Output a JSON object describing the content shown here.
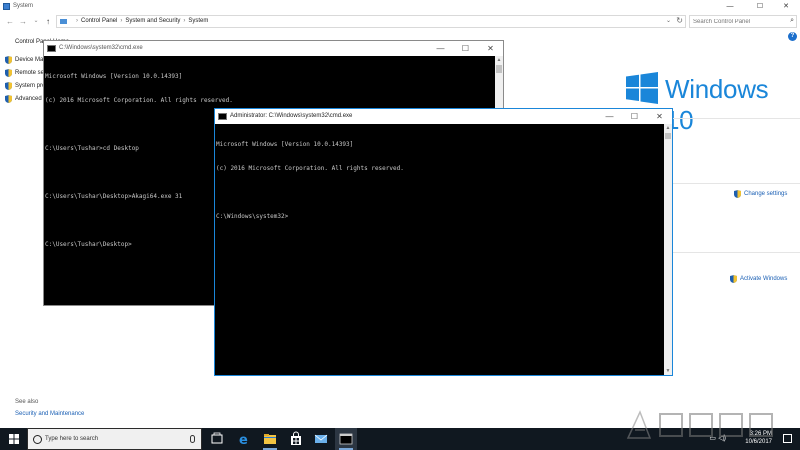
{
  "system_window": {
    "title": "System",
    "controls": {
      "minimize": "—",
      "maximize": "☐",
      "close": "✕"
    },
    "nav": {
      "back": "←",
      "forward": "→",
      "recent": "⌄",
      "up": "↑"
    },
    "breadcrumbs": [
      "Control Panel",
      "System and Security",
      "System"
    ],
    "breadcrumb_sep": "›",
    "search_placeholder": "Search Control Panel",
    "help": "?",
    "sidebar_home": "Control Panel Home",
    "sidebar_links": [
      "Device Manager",
      "Remote settings",
      "System protection",
      "Advanced system settings"
    ],
    "windows_brand": "Windows 10",
    "change_settings": "Change settings",
    "activate_windows": "Activate Windows",
    "see_also": "See also",
    "security_maintenance": "Security and Maintenance"
  },
  "cmd_windows": [
    {
      "title": "C:\\Windows\\system32\\cmd.exe",
      "lines": [
        "Microsoft Windows [Version 10.0.14393]",
        "(c) 2016 Microsoft Corporation. All rights reserved.",
        "",
        "C:\\Users\\Tushar>cd Desktop",
        "",
        "C:\\Users\\Tushar\\Desktop>Akagi64.exe 31",
        "",
        "C:\\Users\\Tushar\\Desktop>"
      ]
    },
    {
      "title": "Administrator: C:\\Windows\\system32\\cmd.exe",
      "lines": [
        "Microsoft Windows [Version 10.0.14393]",
        "(c) 2016 Microsoft Corporation. All rights reserved.",
        "",
        "C:\\Windows\\system32>"
      ]
    }
  ],
  "taskbar": {
    "search_placeholder": "Type here to search",
    "time": "3:26 PM",
    "date": "10/6/2017",
    "apps": [
      "task-view",
      "edge",
      "file-explorer",
      "store",
      "mail",
      "cmd"
    ]
  },
  "colors": {
    "accent": "#1a86d9",
    "link": "#1a5fb4",
    "taskbar": "#101820",
    "console_bg": "#000000",
    "console_fg": "#c8c8c8"
  }
}
